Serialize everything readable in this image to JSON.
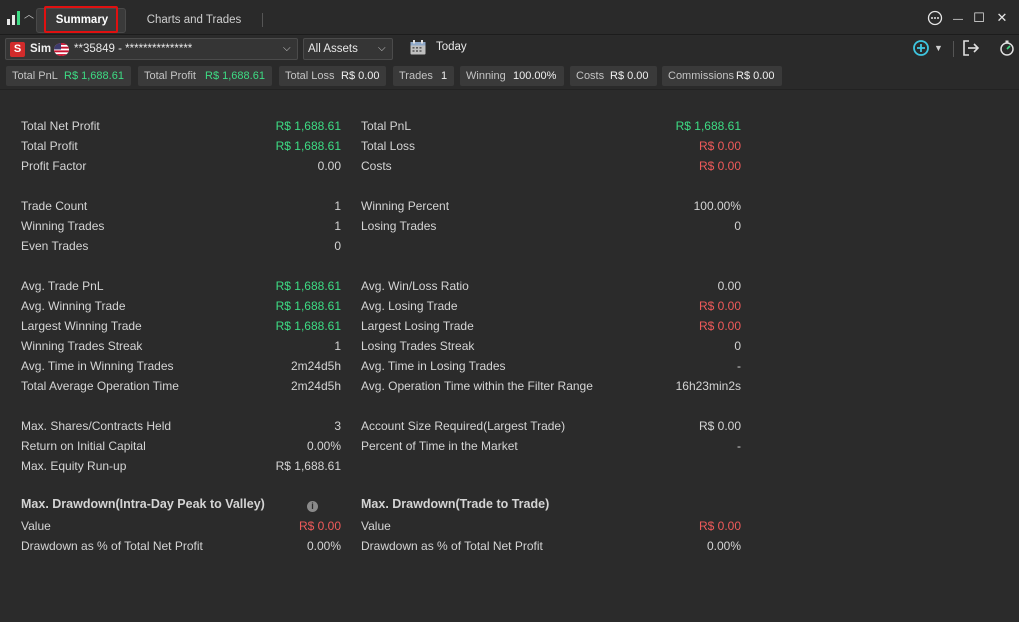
{
  "titlebar": {
    "tabs": [
      {
        "label": "Summary",
        "active": true
      },
      {
        "label": "Charts and Trades",
        "active": false
      }
    ],
    "icons": [
      "more-icon",
      "minimize-icon",
      "maximize-icon",
      "close-icon"
    ],
    "glyphs": {
      "more": "⋯",
      "minimize": "—",
      "maximize": "☐",
      "close": "✕"
    }
  },
  "toolbar": {
    "account": {
      "badge": "S",
      "label": "Sim",
      "number": "**35849 - ***************",
      "flag": "us-flag-icon"
    },
    "assets": "All Assets",
    "date": "Today",
    "chevron": "⌵"
  },
  "stats": [
    {
      "key": "Total PnL",
      "value": "R$ 1,688.61",
      "color": "green"
    },
    {
      "key": "Total Profit",
      "value": "R$ 1,688.61",
      "color": "green"
    },
    {
      "key": "Total Loss",
      "value": "R$ 0.00",
      "color": "plain"
    },
    {
      "key": "Trades",
      "value": "1",
      "color": "plain"
    },
    {
      "key": "Winning",
      "value": "100.00%",
      "color": "plain"
    },
    {
      "key": "Costs",
      "value": "R$ 0.00",
      "color": "plain"
    },
    {
      "key": "Commissions",
      "value": "R$ 0.00",
      "color": "plain"
    }
  ],
  "summary": {
    "left": [
      {
        "label": "Total Net Profit",
        "value": "R$ 1,688.61",
        "color": "green"
      },
      {
        "label": "Total Profit",
        "value": "R$ 1,688.61",
        "color": "green"
      },
      {
        "label": "Profit Factor",
        "value": "0.00",
        "color": "plain"
      },
      {
        "label": "Trade Count",
        "value": "1",
        "color": "plain"
      },
      {
        "label": "Winning Trades",
        "value": "1",
        "color": "plain"
      },
      {
        "label": "Even Trades",
        "value": "0",
        "color": "plain"
      },
      {
        "label": "Avg. Trade PnL",
        "value": "R$ 1,688.61",
        "color": "green"
      },
      {
        "label": "Avg. Winning Trade",
        "value": "R$ 1,688.61",
        "color": "green"
      },
      {
        "label": "Largest Winning Trade",
        "value": "R$ 1,688.61",
        "color": "green"
      },
      {
        "label": "Winning Trades Streak",
        "value": "1",
        "color": "plain"
      },
      {
        "label": "Avg. Time in Winning Trades",
        "value": "2m24d5h",
        "color": "plain"
      },
      {
        "label": "Total Average Operation Time",
        "value": "2m24d5h",
        "color": "plain"
      },
      {
        "label": "Max. Shares/Contracts Held",
        "value": "3",
        "color": "plain"
      },
      {
        "label": "Return on Initial Capital",
        "value": "0.00%",
        "color": "plain"
      },
      {
        "label": "Max. Equity Run-up",
        "value": "R$ 1,688.61",
        "color": "plain"
      }
    ],
    "right": [
      {
        "label": "Total PnL",
        "value": "R$ 1,688.61",
        "color": "green"
      },
      {
        "label": "Total Loss",
        "value": "R$ 0.00",
        "color": "red"
      },
      {
        "label": "Costs",
        "value": "R$ 0.00",
        "color": "red"
      },
      {
        "label": "Winning Percent",
        "value": "100.00%",
        "color": "plain"
      },
      {
        "label": "Losing Trades",
        "value": "0",
        "color": "plain"
      },
      {
        "label": "Avg. Win/Loss Ratio",
        "value": "0.00",
        "color": "plain"
      },
      {
        "label": "Avg. Losing Trade",
        "value": "R$ 0.00",
        "color": "red"
      },
      {
        "label": "Largest Losing Trade",
        "value": "R$ 0.00",
        "color": "red"
      },
      {
        "label": "Losing Trades Streak",
        "value": "0",
        "color": "plain"
      },
      {
        "label": "Avg. Time in Losing Trades",
        "value": "-",
        "color": "plain"
      },
      {
        "label": "Avg. Operation Time within the Filter Range",
        "value": "16h23min2s",
        "color": "plain"
      },
      {
        "label": "Account Size Required(Largest Trade)",
        "value": "R$ 0.00",
        "color": "plain"
      },
      {
        "label": "Percent of Time in the Market",
        "value": "-",
        "color": "plain"
      }
    ]
  },
  "drawdown": {
    "left": {
      "title": "Max. Drawdown(Intra-Day Peak to Valley)",
      "info": "i",
      "rows": [
        {
          "label": "Value",
          "value": "R$ 0.00",
          "color": "red"
        },
        {
          "label": "Drawdown as % of Total Net Profit",
          "value": "0.00%",
          "color": "plain"
        }
      ]
    },
    "right": {
      "title": "Max. Drawdown(Trade to Trade)",
      "rows": [
        {
          "label": "Value",
          "value": "R$ 0.00",
          "color": "red"
        },
        {
          "label": "Drawdown as % of Total Net Profit",
          "value": "0.00%",
          "color": "plain"
        }
      ]
    }
  },
  "colors": {
    "green": "#3ddc84",
    "red": "#ef5a5a",
    "background": "#2b2b2b",
    "highlight": "#e01010"
  }
}
